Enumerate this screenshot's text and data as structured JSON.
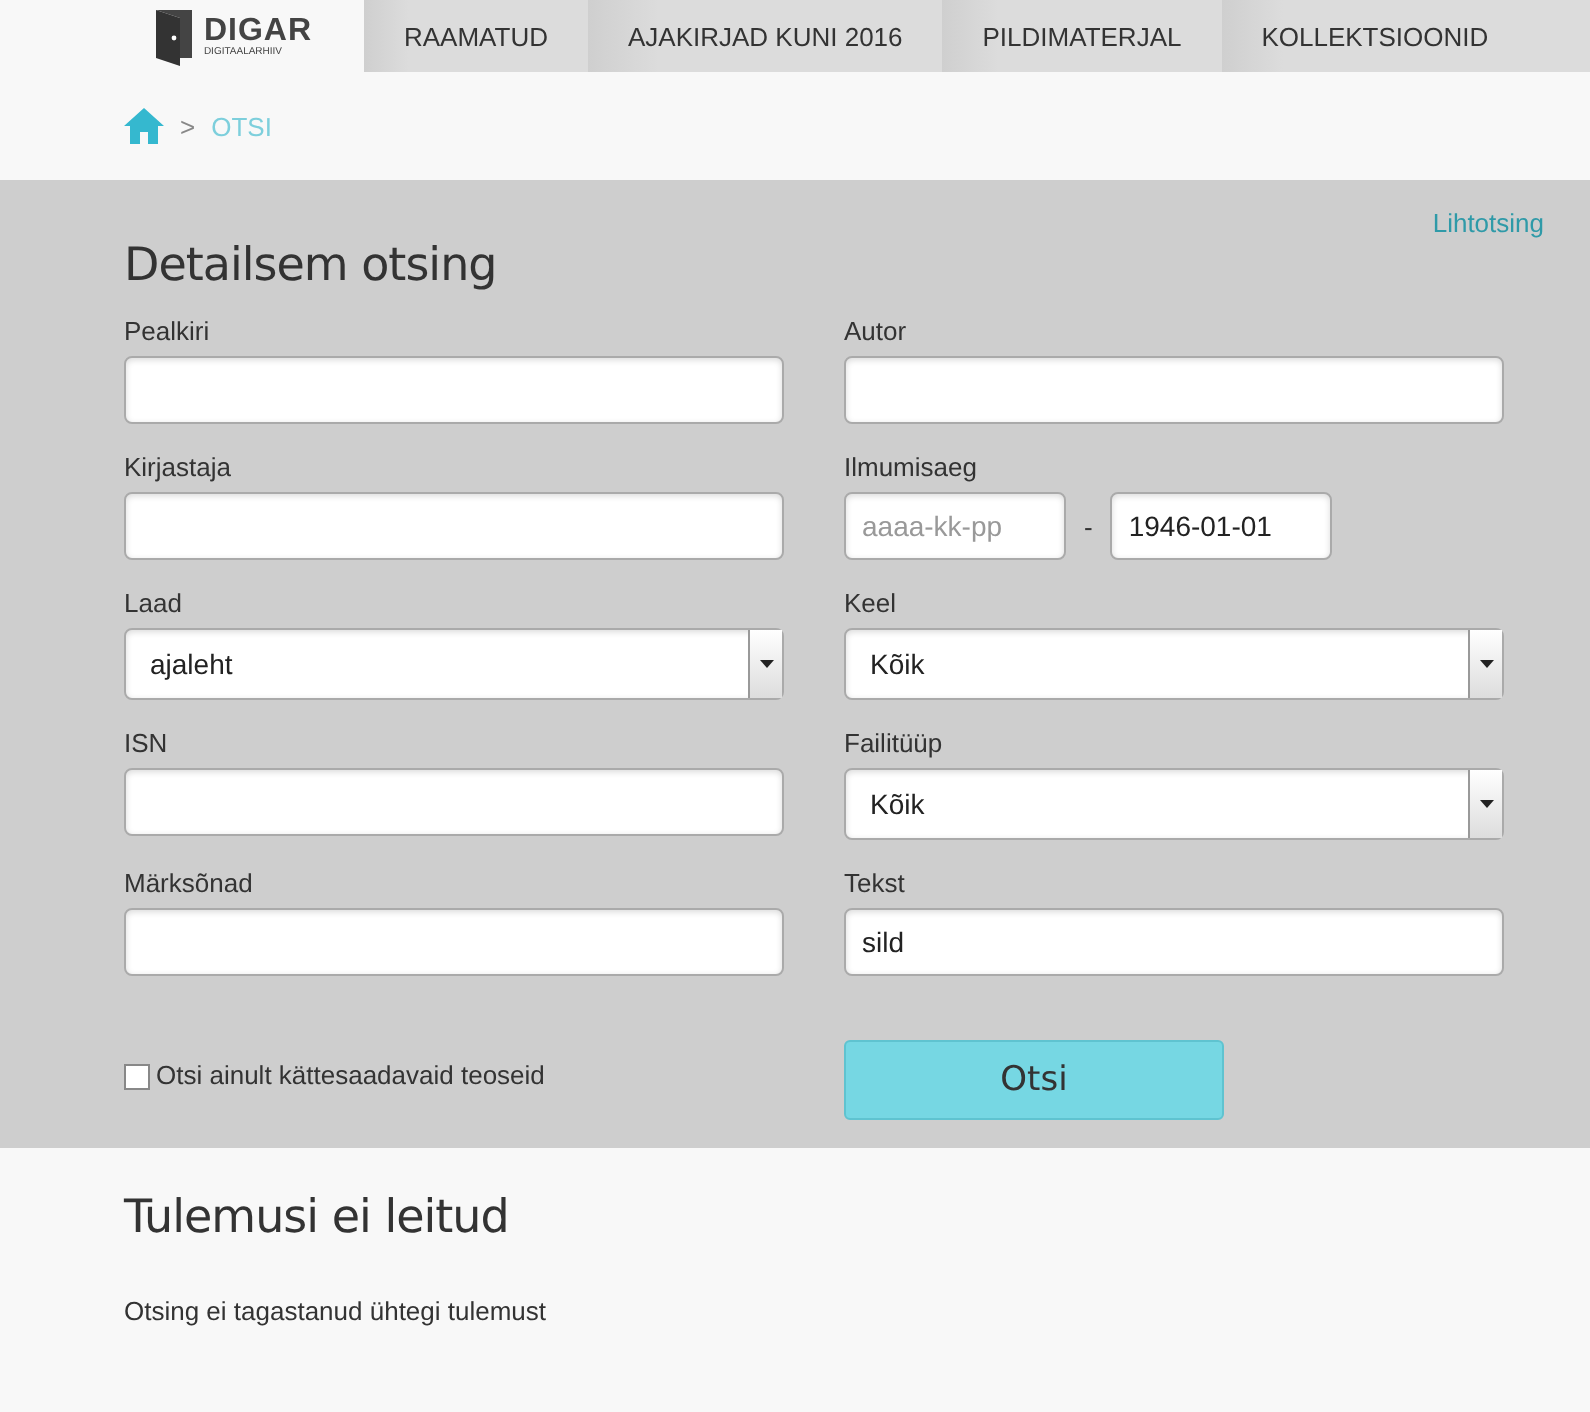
{
  "logo": {
    "name": "DIGAR",
    "tagline": "DIGITAALARHIIV"
  },
  "nav": [
    {
      "label": "RAAMATUD",
      "selected": false
    },
    {
      "label": "AJAKIRJAD KUNI 2016",
      "selected": false
    },
    {
      "label": "PILDIMATERJAL",
      "selected": false
    },
    {
      "label": "KOLLEKTSIOONID",
      "selected": false
    }
  ],
  "breadcrumb": {
    "separator": ">",
    "current": "OTSI"
  },
  "search": {
    "simple_link": "Lihtotsing",
    "title": "Detailsem otsing",
    "fields": [
      {
        "kind": "text",
        "label": "Pealkiri"
      },
      {
        "kind": "text",
        "label": "Autor"
      },
      {
        "kind": "text",
        "label": "Kirjastaja"
      },
      {
        "kind": "daterange",
        "label": "Ilmumisaeg",
        "from_placeholder": "aaaa-kk-pp",
        "separator": "-",
        "to_value": "1946-01-01"
      },
      {
        "kind": "select",
        "label": "Laad",
        "value": "ajaleht"
      },
      {
        "kind": "select",
        "label": "Keel",
        "value": "Kõik"
      },
      {
        "kind": "text",
        "label": "ISN"
      },
      {
        "kind": "select",
        "label": "Failitüüp",
        "value": "Kõik"
      },
      {
        "kind": "text",
        "label": "Märksõnad"
      },
      {
        "kind": "text",
        "label": "Tekst",
        "value": "sild"
      }
    ],
    "available_only": {
      "label": "Otsi ainult kättesaadavaid teoseid",
      "checked": false
    },
    "submit": "Otsi"
  },
  "results": {
    "title": "Tulemusi ei leitud",
    "message": "Otsing ei tagastanud ühtegi tulemust"
  }
}
